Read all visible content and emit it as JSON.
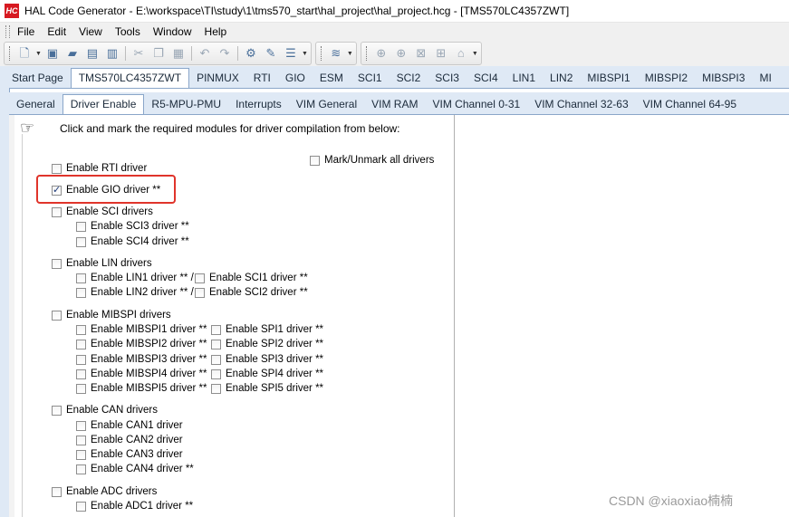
{
  "window": {
    "logo": "HC",
    "title": "HAL Code Generator - E:\\workspace\\TI\\study\\1\\tms570_start\\hal_project\\hal_project.hcg - [TMS570LC4357ZWT]"
  },
  "menu": [
    "File",
    "Edit",
    "View",
    "Tools",
    "Window",
    "Help"
  ],
  "toolbar": {
    "icons": [
      "new-icon",
      "open-icon",
      "folder-icon",
      "save-icon",
      "save-all-icon",
      "cut-icon",
      "copy-icon",
      "paste-icon",
      "undo-icon",
      "redo-icon",
      "generate-icon",
      "options-icon",
      "list-icon",
      "layers-icon",
      "circle-icon",
      "circle-icon",
      "export-icon",
      "home-icon"
    ]
  },
  "device_tabs": [
    "Start Page",
    "TMS570LC4357ZWT",
    "PINMUX",
    "RTI",
    "GIO",
    "ESM",
    "SCI1",
    "SCI2",
    "SCI3",
    "SCI4",
    "LIN1",
    "LIN2",
    "MIBSPI1",
    "MIBSPI2",
    "MIBSPI3",
    "MI"
  ],
  "device_tab_active": 1,
  "config_tabs": [
    "General",
    "Driver Enable",
    "R5-MPU-PMU",
    "Interrupts",
    "VIM General",
    "VIM RAM",
    "VIM Channel 0-31",
    "VIM Channel 32-63",
    "VIM Channel 64-95"
  ],
  "config_tab_active": 1,
  "panel": {
    "instruction": "Click and mark the required modules for driver compilation from below:",
    "mark_all": "Mark/Unmark all drivers",
    "rti": "Enable RTI driver",
    "gio": "Enable GIO driver **",
    "sci": "Enable SCI drivers",
    "sci3": "Enable SCI3 driver **",
    "sci4": "Enable SCI4 driver **",
    "lin": "Enable LIN drivers",
    "lin1": "Enable LIN1 driver ** /",
    "sci1": "Enable SCI1 driver **",
    "lin2": "Enable LIN2 driver ** /",
    "sci2": "Enable SCI2 driver **",
    "mibspi": "Enable MIBSPI drivers",
    "mibspi1": "Enable MIBSPI1 driver **",
    "mibspi2": "Enable MIBSPI2 driver **",
    "mibspi3": "Enable MIBSPI3 driver **",
    "mibspi4": "Enable MIBSPI4 driver **",
    "mibspi5": "Enable MIBSPI5 driver **",
    "spi1": "Enable SPI1 driver **",
    "spi2": "Enable SPI2 driver **",
    "spi3": "Enable SPI3 driver **",
    "spi4": "Enable SPI4 driver **",
    "spi5": "Enable SPI5 driver **",
    "can": "Enable CAN drivers",
    "can1": "Enable CAN1 driver",
    "can2": "Enable CAN2 driver",
    "can3": "Enable CAN3 driver",
    "can4": "Enable CAN4 driver **",
    "adc": "Enable ADC drivers",
    "adc1": "Enable ADC1 driver **"
  },
  "checked": {
    "gio": true
  },
  "watermark": "CSDN @xiaoxiao楠楠",
  "colors": {
    "highlight": "#e0342b",
    "tab_bg": "#dfe9f5",
    "logo": "#d71921"
  }
}
